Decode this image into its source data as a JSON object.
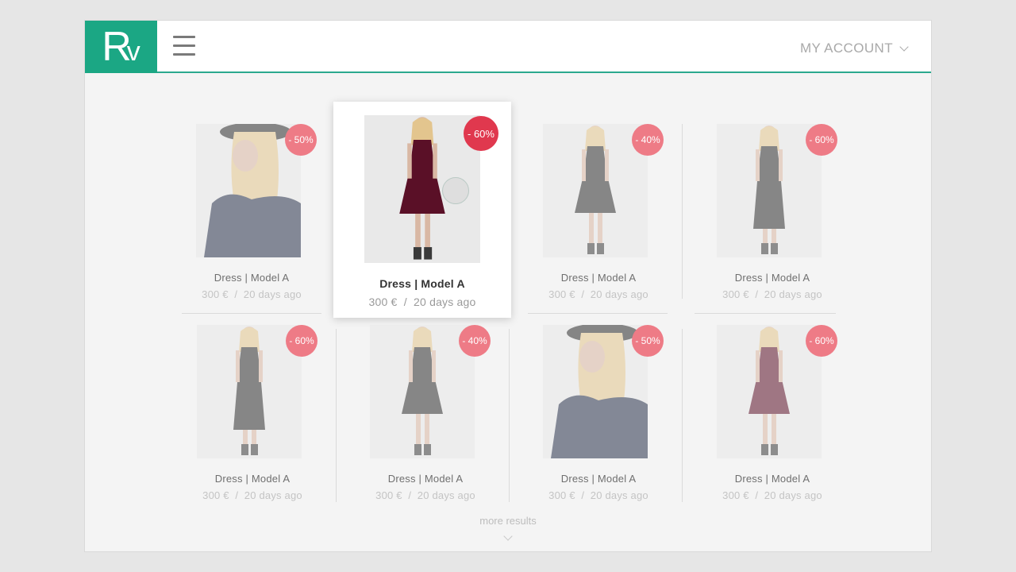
{
  "header": {
    "logo_main": "R",
    "logo_small": "v",
    "account_label": "MY ACCOUNT"
  },
  "products": [
    {
      "name": "Dress | Model A",
      "price": "300 €",
      "sep": "/",
      "age": "20 days ago",
      "discount": "- 50%",
      "variant": "sweater"
    },
    {
      "name": "Dress | Model A",
      "price": "300 €",
      "sep": "/",
      "age": "20 days ago",
      "discount": "- 60%",
      "variant": "burgundy"
    },
    {
      "name": "Dress | Model A",
      "price": "300 €",
      "sep": "/",
      "age": "20 days ago",
      "discount": "- 40%",
      "variant": "short-black"
    },
    {
      "name": "Dress | Model A",
      "price": "300 €",
      "sep": "/",
      "age": "20 days ago",
      "discount": "- 60%",
      "variant": "long-black"
    },
    {
      "name": "Dress | Model A",
      "price": "300 €",
      "sep": "/",
      "age": "20 days ago",
      "discount": "- 60%",
      "variant": "long-black"
    },
    {
      "name": "Dress | Model A",
      "price": "300 €",
      "sep": "/",
      "age": "20 days ago",
      "discount": "- 40%",
      "variant": "short-black"
    },
    {
      "name": "Dress | Model A",
      "price": "300 €",
      "sep": "/",
      "age": "20 days ago",
      "discount": "- 50%",
      "variant": "sweater"
    },
    {
      "name": "Dress | Model A",
      "price": "300 €",
      "sep": "/",
      "age": "20 days ago",
      "discount": "- 60%",
      "variant": "burgundy"
    }
  ],
  "more_results": "more results",
  "colors": {
    "brand": "#1ba784",
    "badge": "#ee7b86",
    "badge_active": "#e0384e"
  },
  "icons": {
    "menu": "hamburger-icon",
    "account_chevron": "chevron-down-icon",
    "more_chevron": "chevron-down-icon"
  }
}
